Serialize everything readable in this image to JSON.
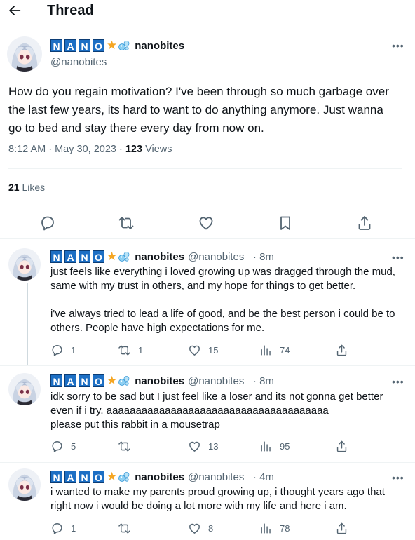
{
  "header": {
    "title": "Thread"
  },
  "colors": {
    "accent": "#1d9bf0",
    "text": "#0f1419",
    "muted": "#536471",
    "name_box": "#1d6fc4",
    "star": "#f5a623"
  },
  "name_letters": [
    "N",
    "A",
    "N",
    "O"
  ],
  "icons": {
    "back": "arrow-left-icon",
    "more": "more-horizontal-icon",
    "star": "star-icon",
    "bubbles": "bubbles-icon",
    "reply": "reply-icon",
    "retweet": "retweet-icon",
    "like": "heart-icon",
    "bookmark": "bookmark-icon",
    "share": "share-icon",
    "views": "views-icon"
  },
  "main_tweet": {
    "display_name": "nanobites",
    "handle": "@nanobites_",
    "text_lines": [
      "How do you regain motivation? I've been through so much garbage over",
      "the last few years, its hard to want to do anything anymore. Just wanna",
      "go to bed and stay there every day from now on."
    ],
    "timestamp": "8:12 AM · May 30, 2023",
    "views_count": "123",
    "views_label": "Views",
    "likes_count": "21",
    "likes_label": "Likes"
  },
  "replies": [
    {
      "display_name": "nanobites",
      "handle": "@nanobites_",
      "time": "8m",
      "text_lines": [
        "just feels like everything i loved growing up was dragged through the mud,",
        "same with my trust in others, and my hope for things to get better.",
        "",
        "i've always tried to lead a life of good, and be the best person i could be to",
        "others. People have high expectations for me."
      ],
      "replies": "1",
      "retweets": "1",
      "likes": "15",
      "views": "74"
    },
    {
      "display_name": "nanobites",
      "handle": "@nanobites_",
      "time": "8m",
      "text_lines": [
        "idk sorry to be sad but I just feel like a loser and its not gonna get better",
        "even if i try. aaaaaaaaaaaaaaaaaaaaaaaaaaaaaaaaaaaaaa",
        "please put this rabbit in a mousetrap"
      ],
      "replies": "5",
      "retweets": "",
      "likes": "13",
      "views": "95"
    },
    {
      "display_name": "nanobites",
      "handle": "@nanobites_",
      "time": "4m",
      "text_lines": [
        "i wanted to make my parents proud growing up, i thought years ago that",
        "right now i would be doing a lot more with my life and here i am."
      ],
      "replies": "1",
      "retweets": "",
      "likes": "8",
      "views": "78"
    }
  ]
}
